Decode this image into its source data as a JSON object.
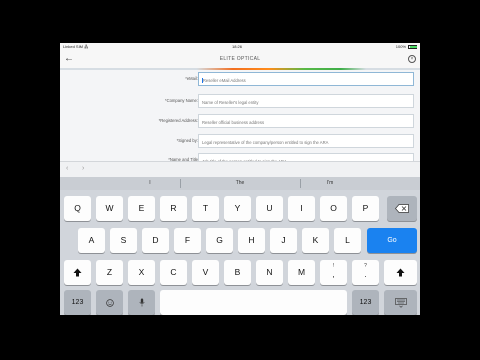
{
  "status": {
    "carrier": "Linked SIM ⁂",
    "time": "18:26",
    "battery": "100%"
  },
  "nav": {
    "back_icon": "back-arrow-icon",
    "title": "ELITE OPTICAL",
    "close_icon": "close-circle-icon"
  },
  "accent_colors": [
    "#f26f21",
    "#ff8c1a",
    "#58b947",
    "#3fae49"
  ],
  "form": {
    "rows": [
      {
        "label": "*eMail:",
        "placeholder": "Reseller eMail Address"
      },
      {
        "label": "*Company Name:",
        "placeholder": "Name of Reseller's legal entity"
      },
      {
        "label": "*Registered Address:",
        "placeholder": "Reseller official business address"
      },
      {
        "label": "*Signed by:",
        "placeholder": "Legal representative of the company/person entitled to sign the ARA"
      },
      {
        "label": "*Name and Title",
        "placeholder": "Job title of the person entitled to sign the ARA"
      }
    ]
  },
  "toolbar": {
    "prev_icon": "chevron-left-icon",
    "next_icon": "chevron-right-icon"
  },
  "suggestions": [
    "I",
    "The",
    "I'm"
  ],
  "keyboard": {
    "row1": [
      "Q",
      "W",
      "E",
      "R",
      "T",
      "Y",
      "U",
      "I",
      "O",
      "P"
    ],
    "row2": [
      "A",
      "S",
      "D",
      "F",
      "G",
      "H",
      "J",
      "K",
      "L"
    ],
    "row3": [
      "Z",
      "X",
      "C",
      "V",
      "B",
      "N",
      "M"
    ],
    "punct1_top": "!",
    "punct1_bottom": ",",
    "punct2_top": "?",
    "punct2_bottom": ".",
    "go": "Go",
    "numbers": "123",
    "shift_icon": "shift-arrow-icon",
    "backspace_icon": "backspace-icon",
    "emoji_icon": "emoji-icon",
    "mic_icon": "microphone-icon",
    "hide_keyboard_icon": "hide-keyboard-icon"
  }
}
